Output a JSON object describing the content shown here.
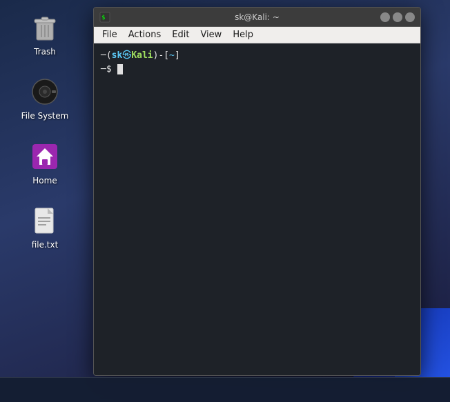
{
  "desktop": {
    "icons": [
      {
        "id": "trash",
        "label": "Trash",
        "type": "trash"
      },
      {
        "id": "filesystem",
        "label": "File System",
        "type": "filesystem"
      },
      {
        "id": "home",
        "label": "Home",
        "type": "home"
      },
      {
        "id": "filetxt",
        "label": "file.txt",
        "type": "file"
      }
    ]
  },
  "terminal": {
    "title": "sk@Kali: ~",
    "menu": {
      "items": [
        "File",
        "Actions",
        "Edit",
        "View",
        "Help"
      ]
    },
    "prompt": {
      "open_bracket": "─(",
      "user": "sk",
      "at": "㉿",
      "host": "Kali",
      "close_bracket": ")-[~]",
      "dollar": "─$"
    },
    "window_controls": {
      "minimize": "–",
      "maximize": "□",
      "close": "×"
    }
  }
}
